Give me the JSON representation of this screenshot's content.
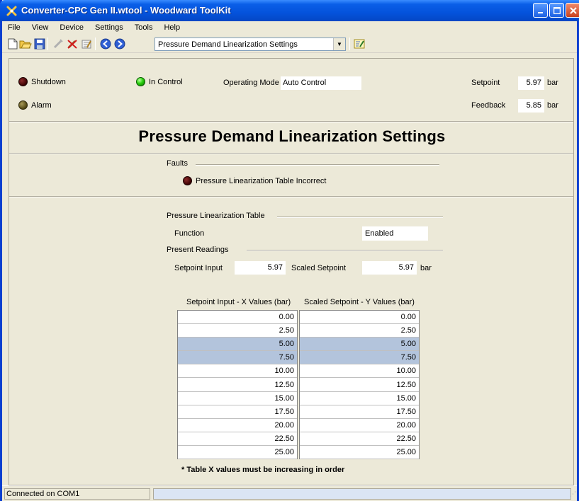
{
  "window": {
    "title": "Converter-CPC Gen II.wtool - Woodward ToolKit"
  },
  "menu": [
    "File",
    "View",
    "Device",
    "Settings",
    "Tools",
    "Help"
  ],
  "toolbar": {
    "page_selector_value": "Pressure Demand Linearization Settings",
    "icons": [
      "new-icon",
      "open-icon",
      "save-icon",
      "connect-icon",
      "disconnect-icon",
      "properties-icon",
      "back-icon",
      "forward-icon",
      "settings-editor-icon"
    ]
  },
  "status": {
    "shutdown_label": "Shutdown",
    "alarm_label": "Alarm",
    "in_control_label": "In Control",
    "operating_mode_label": "Operating Mode",
    "operating_mode_value": "Auto Control",
    "setpoint_label": "Setpoint",
    "setpoint_value": "5.97",
    "setpoint_unit": "bar",
    "feedback_label": "Feedback",
    "feedback_value": "5.85",
    "feedback_unit": "bar",
    "led_colors": {
      "shutdown": "#3a0000",
      "alarm": "#4f4512",
      "in_control": "#2ad10f"
    }
  },
  "page": {
    "title": "Pressure Demand Linearization Settings",
    "faults_label": "Faults",
    "fault_item": "Pressure Linearization Table Incorrect",
    "table_group_label": "Pressure Linearization Table",
    "function_label": "Function",
    "function_value": "Enabled",
    "present_readings_label": "Present Readings",
    "setpoint_input_label": "Setpoint Input",
    "setpoint_input_value": "5.97",
    "scaled_setpoint_label": "Scaled Setpoint",
    "scaled_setpoint_value": "5.97",
    "scaled_setpoint_unit": "bar",
    "x_header": "Setpoint Input - X Values (bar)",
    "y_header": "Scaled Setpoint - Y Values  (bar)",
    "x_values": [
      "0.00",
      "2.50",
      "5.00",
      "7.50",
      "10.00",
      "12.50",
      "15.00",
      "17.50",
      "20.00",
      "22.50",
      "25.00"
    ],
    "y_values": [
      "0.00",
      "2.50",
      "5.00",
      "7.50",
      "10.00",
      "12.50",
      "15.00",
      "17.50",
      "20.00",
      "22.50",
      "25.00"
    ],
    "highlighted_rows": [
      2,
      3
    ],
    "note": "* Table X values must be increasing in order"
  },
  "statusbar": {
    "connection": "Connected on COM1"
  }
}
